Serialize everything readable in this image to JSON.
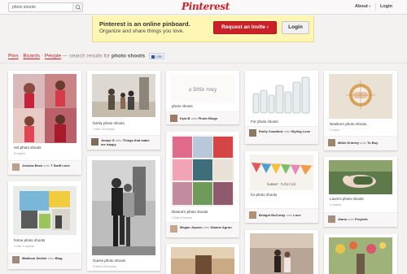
{
  "header": {
    "search_value": "photo shoots",
    "logo": "Pinterest",
    "about": "About",
    "about_caret": "▾",
    "login": "Login"
  },
  "banner": {
    "title": "Pinterest is an online pinboard.",
    "subtitle": "Organize and share things you love.",
    "invite_button": "Request an Invite",
    "invite_arrow": "›",
    "login_button": "Login"
  },
  "results": {
    "pins": "Pins",
    "boards": "Boards",
    "people": "People",
    "sep": "·",
    "text": "— search results for",
    "query": "photo shoots",
    "like": "Like"
  },
  "pins": [
    {
      "caption": "red photo shoots",
      "count": "5 repins",
      "user": "Jessica Beck",
      "onto": "onto",
      "board": "T Swift Love"
    },
    {
      "caption": "home photo shoots",
      "count": "1 like 4 repins",
      "user": "Madison Seeber",
      "onto": "onto",
      "board": "Blog"
    },
    {
      "caption": "family photo shoots",
      "count": "1 like 20 repins",
      "user": "Janayi G",
      "onto": "onto",
      "board": "Things that make me happy"
    },
    {
      "caption": "Guess photo shoots",
      "count": "4 likes 29 repins"
    },
    {
      "image_text": "a little rosy",
      "caption": "photo shoots",
      "user": "Kyla B",
      "onto": "onto",
      "board": "Photo Blogs"
    },
    {
      "caption": "Dianne's photo shoots",
      "count": "1 like 6 repins",
      "user": "Megan Jepsen",
      "onto": "onto",
      "board": "Dianne Agron"
    },
    {
      "caption": "For photo shoots",
      "user": "Emily Crawford",
      "onto": "onto",
      "board": "Styling Love"
    },
    {
      "image_text": "Summer tutorial",
      "caption": "for photo shoots",
      "user": "Bridget McCurdy",
      "onto": "onto",
      "board": "Love"
    },
    {
      "caption": "Newborn photo shoots.",
      "count": "1 repin",
      "user": "Mikki Grimley",
      "onto": "onto",
      "board": "To Buy"
    },
    {
      "caption": "Laura's photo shoots",
      "count": "2 repins",
      "user": "Alana",
      "onto": "onto",
      "board": "Projects"
    }
  ]
}
